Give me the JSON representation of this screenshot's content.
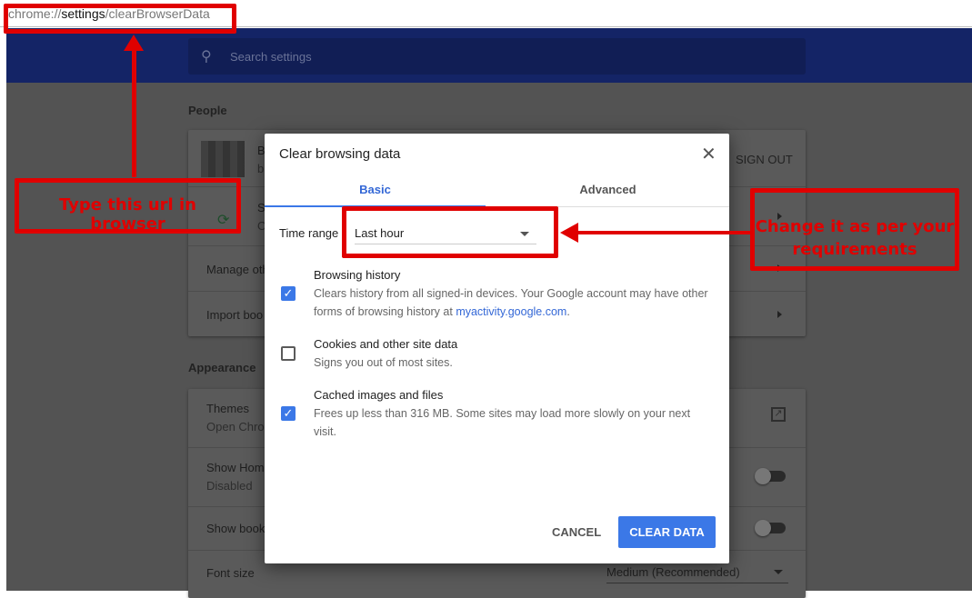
{
  "browser": {
    "url_prefix": "chrome://",
    "url_bold": "settings",
    "url_suffix": "/clearBrowserData"
  },
  "settings": {
    "search_placeholder": "Search settings",
    "people": {
      "heading": "People",
      "profile_name": "B",
      "profile_email": "b",
      "sign_out": "SIGN OUT",
      "sync_title": "S",
      "sync_sub": "O",
      "manage": "Manage oth",
      "import": "Import boo"
    },
    "appearance": {
      "heading": "Appearance",
      "themes": "Themes",
      "themes_sub": "Open Chro",
      "home": "Show Hom",
      "home_sub": "Disabled",
      "bookmarks": "Show book",
      "font_size": "Font size",
      "font_size_value": "Medium (Recommended)"
    }
  },
  "dialog": {
    "title": "Clear browsing data",
    "tabs": [
      {
        "label": "Basic",
        "active": true
      },
      {
        "label": "Advanced",
        "active": false
      }
    ],
    "time_range_label": "Time range",
    "time_range_value": "Last hour",
    "items": [
      {
        "label": "Browsing history",
        "checked": true,
        "desc": "Clears history from all signed-in devices. Your Google account may have other forms of browsing history at ",
        "link": "myactivity.google.com",
        "after": "."
      },
      {
        "label": "Cookies and other site data",
        "checked": false,
        "desc": "Signs you out of most sites."
      },
      {
        "label": "Cached images and files",
        "checked": true,
        "desc": "Frees up less than 316 MB. Some sites may load more slowly on your next visit."
      }
    ],
    "cancel": "CANCEL",
    "clear": "CLEAR DATA"
  },
  "annotations": {
    "url_note": "Type this url in browser",
    "range_note": "Change it as per your requirements"
  },
  "colors": {
    "accent": "#3b78e7",
    "annotation": "#e00000"
  }
}
